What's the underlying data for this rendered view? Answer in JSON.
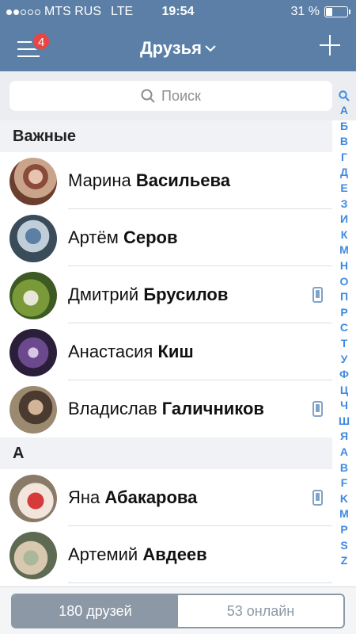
{
  "status_bar": {
    "carrier": "MTS RUS",
    "network": "LTE",
    "time": "19:54",
    "battery": "31 %",
    "battery_level": 0.31,
    "signal_bars_filled": 2,
    "signal_bars_total": 5
  },
  "nav": {
    "title": "Друзья",
    "badge_count": "4"
  },
  "search": {
    "placeholder": "Поиск"
  },
  "sections": [
    {
      "header": "Важные",
      "friends": [
        {
          "first": "Марина",
          "last": "Васильева",
          "mobile": false
        },
        {
          "first": "Артём",
          "last": "Серов",
          "mobile": false
        },
        {
          "first": "Дмитрий",
          "last": "Брусилов",
          "mobile": true
        },
        {
          "first": "Анастасия",
          "last": "Киш",
          "mobile": false
        },
        {
          "first": "Владислав",
          "last": "Галичников",
          "mobile": true
        }
      ]
    },
    {
      "header": "А",
      "friends": [
        {
          "first": "Яна",
          "last": "Абакарова",
          "mobile": true
        },
        {
          "first": "Артемий",
          "last": "Авдеев",
          "mobile": false
        }
      ]
    }
  ],
  "index_letters": [
    "А",
    "Б",
    "В",
    "Г",
    "Д",
    "Е",
    "З",
    "И",
    "К",
    "М",
    "Н",
    "О",
    "П",
    "Р",
    "С",
    "Т",
    "У",
    "Ф",
    "Ц",
    "Ч",
    "Ш",
    "Я",
    "A",
    "B",
    "F",
    "K",
    "M",
    "P",
    "S",
    "Z"
  ],
  "bottom_tabs": {
    "all": "180 друзей",
    "online": "53 онлайн"
  },
  "colors": {
    "nav_bg": "#5b7fa6",
    "accent": "#3f8ae0",
    "badge": "#e64646"
  }
}
